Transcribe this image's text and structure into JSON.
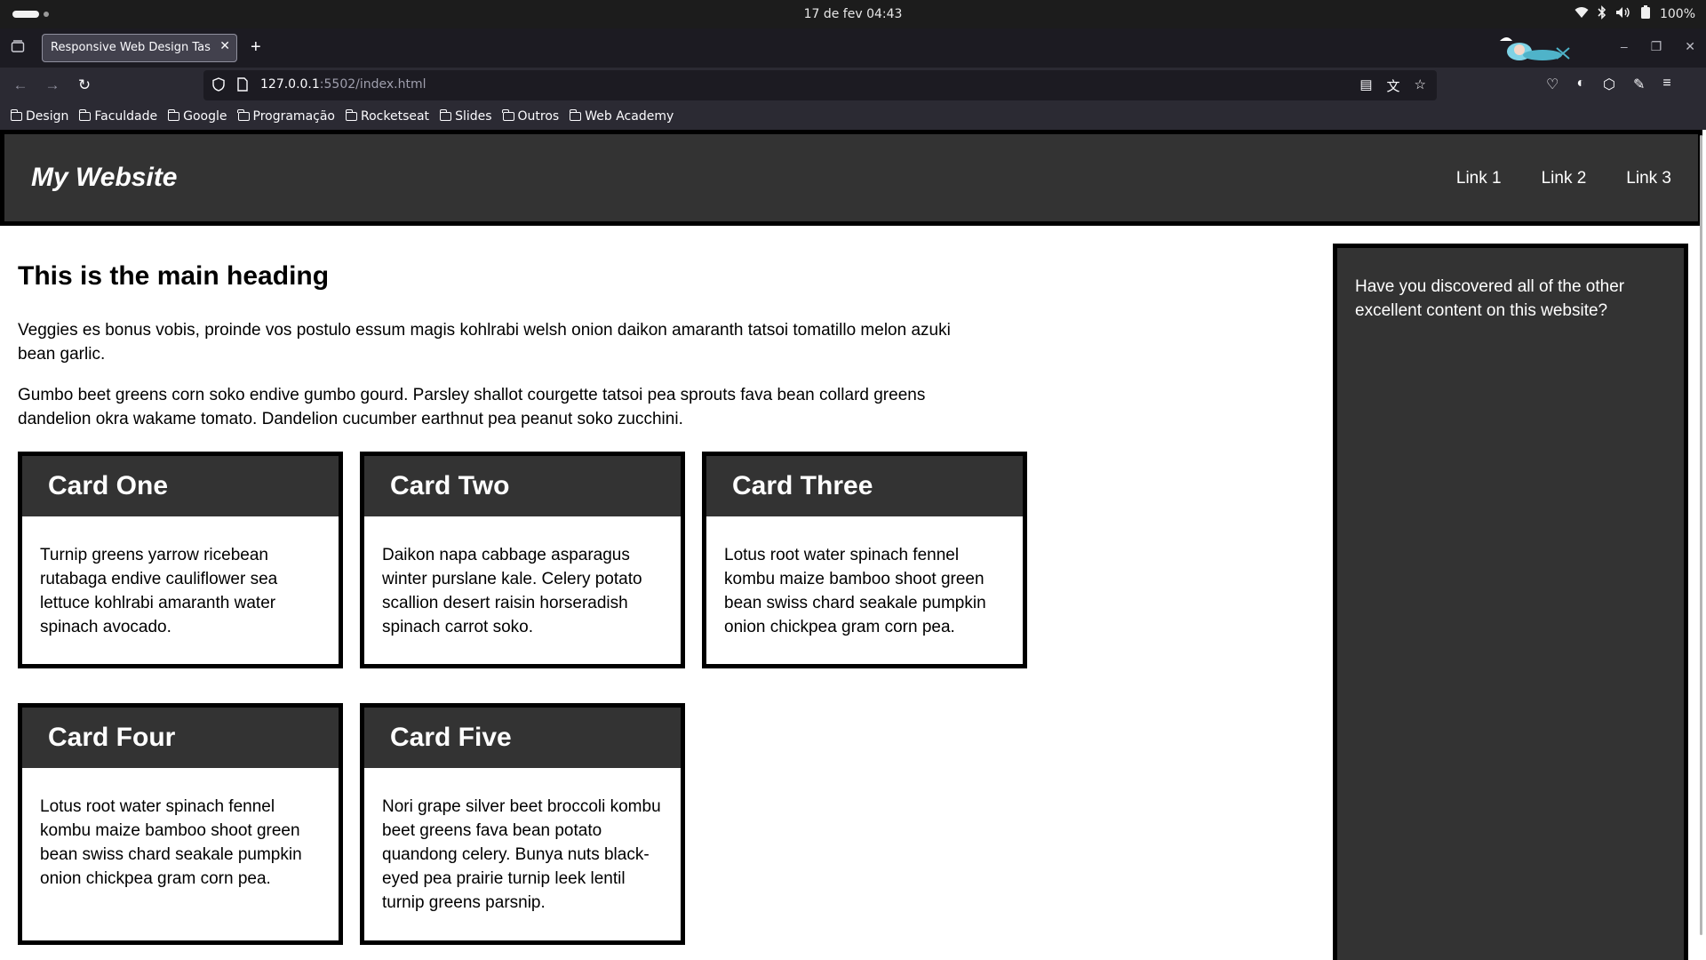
{
  "os": {
    "clock": "17 de fev  04:43",
    "battery": "100%"
  },
  "browser": {
    "tab_title": "Responsive Web Design Task",
    "url_host": "127.0.0.1",
    "url_port_path": ":5502/index.html",
    "bookmarks": [
      "Design",
      "Faculdade",
      "Google",
      "Programação",
      "Rocketseat",
      "Slides",
      "Outros",
      "Web Academy"
    ]
  },
  "site": {
    "logo": "My Website",
    "nav": [
      "Link 1",
      "Link 2",
      "Link 3"
    ],
    "heading": "This is the main heading",
    "paragraphs": [
      "Veggies es bonus vobis, proinde vos postulo essum magis kohlrabi welsh onion daikon amaranth tatsoi tomatillo melon azuki bean garlic.",
      "Gumbo beet greens corn soko endive gumbo gourd. Parsley shallot courgette tatsoi pea sprouts fava bean collard greens dandelion okra wakame tomato. Dandelion cucumber earthnut pea peanut soko zucchini."
    ],
    "cards": [
      {
        "title": "Card One",
        "text": "Turnip greens yarrow ricebean rutabaga endive cauliflower sea lettuce kohlrabi amaranth water spinach avocado."
      },
      {
        "title": "Card Two",
        "text": "Daikon napa cabbage asparagus winter purslane kale. Celery potato scallion desert raisin horseradish spinach carrot soko."
      },
      {
        "title": "Card Three",
        "text": "Lotus root water spinach fennel kombu maize bamboo shoot green bean swiss chard seakale pumpkin onion chickpea gram corn pea."
      },
      {
        "title": "Card Four",
        "text": "Lotus root water spinach fennel kombu maize bamboo shoot green bean swiss chard seakale pumpkin onion chickpea gram corn pea."
      },
      {
        "title": "Card Five",
        "text": "Nori grape silver beet broccoli kombu beet greens fava bean potato quandong celery. Bunya nuts black-eyed pea prairie turnip leek lentil turnip greens parsnip."
      }
    ],
    "aside": "Have you discovered all of the other excellent content on this website?"
  }
}
